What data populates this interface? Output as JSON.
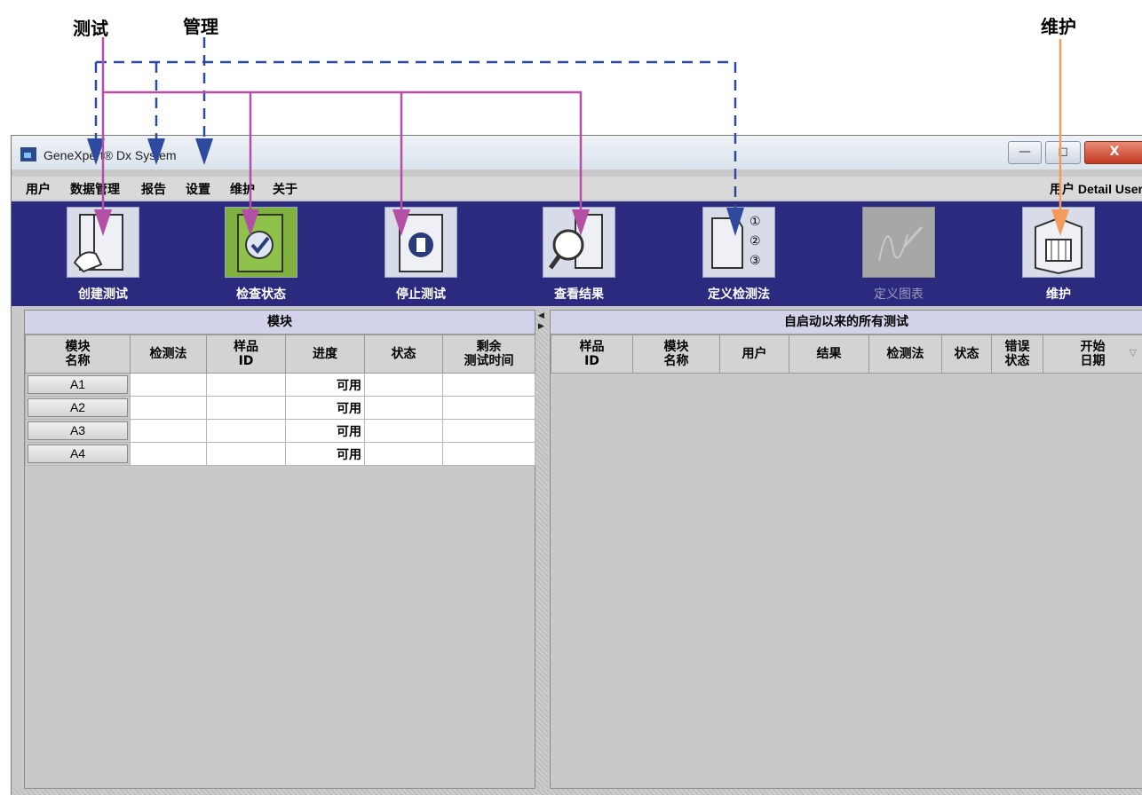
{
  "callouts": {
    "test": "测试",
    "manage": "管理",
    "maintain": "维护"
  },
  "window": {
    "title": "GeneXpert® Dx System",
    "close_label": "X"
  },
  "menu": [
    "用户",
    "数据管理",
    "报告",
    "设置",
    "维护",
    "关于"
  ],
  "user_info": "用户 Detail User",
  "toolbar": [
    {
      "label": "创建测试",
      "icon": "create-test-icon",
      "enabled": true
    },
    {
      "label": "检查状态",
      "icon": "check-status-icon",
      "enabled": true
    },
    {
      "label": "停止测试",
      "icon": "stop-test-icon",
      "enabled": true
    },
    {
      "label": "查看结果",
      "icon": "view-results-icon",
      "enabled": true
    },
    {
      "label": "定义检测法",
      "icon": "define-assay-icon",
      "enabled": true
    },
    {
      "label": "定义图表",
      "icon": "define-chart-icon",
      "enabled": false
    },
    {
      "label": "维护",
      "icon": "maintenance-icon",
      "enabled": true
    }
  ],
  "left_panel": {
    "title": "模块",
    "columns": [
      [
        "模块",
        "名称"
      ],
      [
        "检测法"
      ],
      [
        "样品",
        "ID"
      ],
      [
        "进度"
      ],
      [
        "状态"
      ],
      [
        "剩余",
        "测试时间"
      ]
    ],
    "rows": [
      {
        "module": "A1",
        "progress": "可用"
      },
      {
        "module": "A2",
        "progress": "可用"
      },
      {
        "module": "A3",
        "progress": "可用"
      },
      {
        "module": "A4",
        "progress": "可用"
      }
    ]
  },
  "right_panel": {
    "title": "自启动以来的所有测试",
    "columns": [
      [
        "样品",
        "ID"
      ],
      [
        "模块",
        "名称"
      ],
      [
        "用户"
      ],
      [
        "结果"
      ],
      [
        "检测法"
      ],
      [
        "状态"
      ],
      [
        "错误",
        "状态"
      ],
      [
        "开始",
        "日期"
      ]
    ]
  },
  "colors": {
    "toolbar_bg": "#2b2a7e",
    "test_arrow": "#b44fa6",
    "manage_arrow": "#2e4a9e",
    "maintain_arrow": "#f39a5c"
  }
}
